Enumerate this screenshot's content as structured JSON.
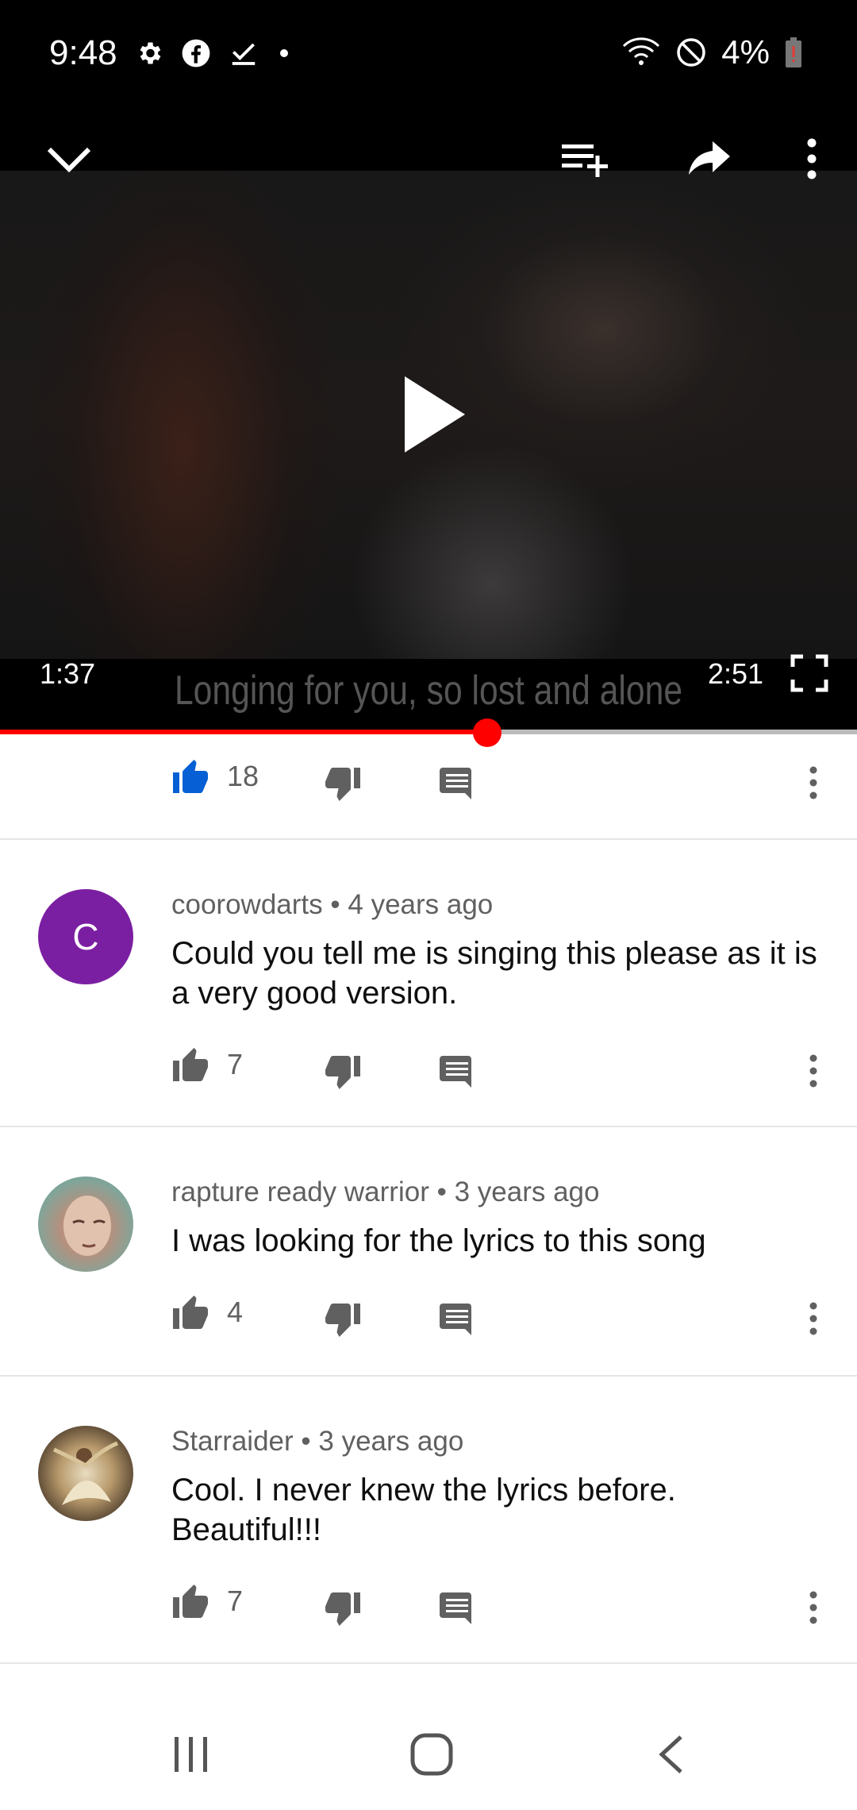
{
  "status": {
    "time": "9:48",
    "battery": "4%"
  },
  "player": {
    "current_time": "1:37",
    "total_time": "2:51",
    "subtitle": "Longing for you, so lost and alone",
    "progress": 0.57
  },
  "video_actions": {
    "likes": "18"
  },
  "comments": [
    {
      "author": "coorowdarts",
      "age": "4 years ago",
      "text": "Could you tell me is singing this please as it is a very good version.",
      "likes": "7",
      "avatar_letter": "C",
      "avatar_color": "#7b1fa2"
    },
    {
      "author": "rapture ready warrior",
      "age": "3 years ago",
      "text": "I was looking for the lyrics to this song",
      "likes": "4"
    },
    {
      "author": "Starraider",
      "age": "3 years ago",
      "text": "Cool. I never  knew the lyrics before. Beautiful!!!",
      "likes": "7"
    }
  ],
  "separator": "•",
  "colors": {
    "accent_red": "#ff0000",
    "like_blue": "#065fd4",
    "icon_gray": "#606060"
  }
}
